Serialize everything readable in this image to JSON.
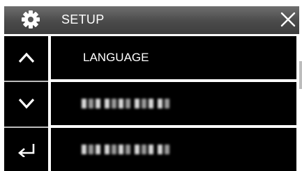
{
  "header": {
    "title": "SETUP",
    "settings_icon": "gear-icon",
    "close_icon": "close-icon"
  },
  "sidebar": {
    "buttons": [
      {
        "name": "scroll-up-button",
        "icon": "chevron-up-icon"
      },
      {
        "name": "scroll-down-button",
        "icon": "chevron-down-icon"
      },
      {
        "name": "back-button",
        "icon": "return-arrow-icon"
      }
    ]
  },
  "menu": {
    "items": [
      {
        "label": "LANGUAGE"
      }
    ]
  },
  "colors": {
    "header_top": "#6e6e6e",
    "header_bottom": "#3e3e3e",
    "panel": "#000000",
    "text": "#ffffff",
    "divider": "#bdbdbd"
  }
}
